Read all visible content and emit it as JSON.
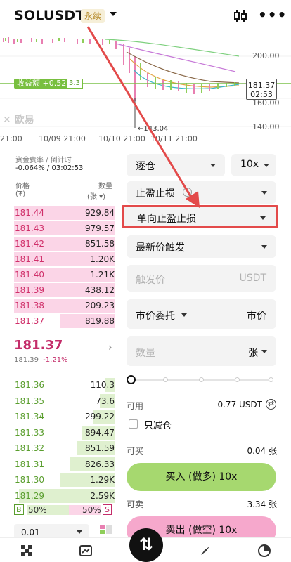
{
  "header": {
    "symbol": "SOLUSDT",
    "contract_tag": "永续",
    "icons": [
      "caret-down-icon",
      "candlestick-icon",
      "more-icon"
    ]
  },
  "chart": {
    "price_ticks": [
      "200.00",
      "160.00",
      "140.00"
    ],
    "current_price": "181.37",
    "countdown": "02:53",
    "pnl_label": "收益额 +0.52",
    "pnl_leverage": "3.3",
    "low_mark": "143.04",
    "watermark": "欧易",
    "time_labels": [
      "21:00",
      "10/09 21:00",
      "10/10 21:00",
      "10/11 21:00"
    ]
  },
  "funding": {
    "label": "资金费率 / 倒计时",
    "value": "-0.064% / 03:02:53"
  },
  "book": {
    "price_header": "价格",
    "price_unit": "(₮)",
    "qty_header": "数量",
    "qty_unit": "(张 ▾)",
    "asks": [
      {
        "price": "181.44",
        "qty": "929.84",
        "depth": 1.0
      },
      {
        "price": "181.43",
        "qty": "979.57",
        "depth": 1.0
      },
      {
        "price": "181.42",
        "qty": "851.58",
        "depth": 1.0
      },
      {
        "price": "181.41",
        "qty": "1.20K",
        "depth": 1.0
      },
      {
        "price": "181.40",
        "qty": "1.21K",
        "depth": 1.0
      },
      {
        "price": "181.39",
        "qty": "438.12",
        "depth": 1.0
      },
      {
        "price": "181.38",
        "qty": "209.23",
        "depth": 1.0
      },
      {
        "price": "181.37",
        "qty": "819.88",
        "depth": 0.55
      }
    ],
    "last_price": "181.37",
    "mark_price": "181.39",
    "change": "-1.21%",
    "bids": [
      {
        "price": "181.36",
        "qty": "110.3",
        "depth": 0.1
      },
      {
        "price": "181.35",
        "qty": "73.6",
        "depth": 0.15
      },
      {
        "price": "181.34",
        "qty": "299.22",
        "depth": 0.22
      },
      {
        "price": "181.33",
        "qty": "894.47",
        "depth": 0.33
      },
      {
        "price": "181.32",
        "qty": "851.59",
        "depth": 0.38
      },
      {
        "price": "181.31",
        "qty": "826.33",
        "depth": 0.45
      },
      {
        "price": "181.30",
        "qty": "1.29K",
        "depth": 0.55
      },
      {
        "price": "181.29",
        "qty": "2.59K",
        "depth": 0.95
      }
    ],
    "buy_tag": "B",
    "buy_pct": "50%",
    "sell_pct": "50%",
    "sell_tag": "S",
    "precision": "0.01"
  },
  "order": {
    "margin_mode": "逐仓",
    "leverage": "10x",
    "tp_sl": "止盈止损",
    "tp_sl_mode": "单向止盈止损",
    "trigger_type": "最新价触发",
    "trigger_placeholder": "触发价",
    "trigger_unit": "USDT",
    "order_type": "市价委托",
    "order_type_value": "市价",
    "qty_placeholder": "数量",
    "qty_unit": "张",
    "avail_label": "可用",
    "avail_value": "0.77 USDT",
    "reduce_only": "只减仓",
    "can_buy_label": "可买",
    "can_buy_value": "0.04 张",
    "buy_btn": "买入 (做多) 10x",
    "can_sell_label": "可卖",
    "can_sell_value": "3.34 张",
    "sell_btn": "卖出 (做空) 10x"
  },
  "colors": {
    "buy": "#a6d86f",
    "sell": "#f6a8cc",
    "highlight_border": "#e34a4a",
    "arrow": "#e34a4a"
  }
}
